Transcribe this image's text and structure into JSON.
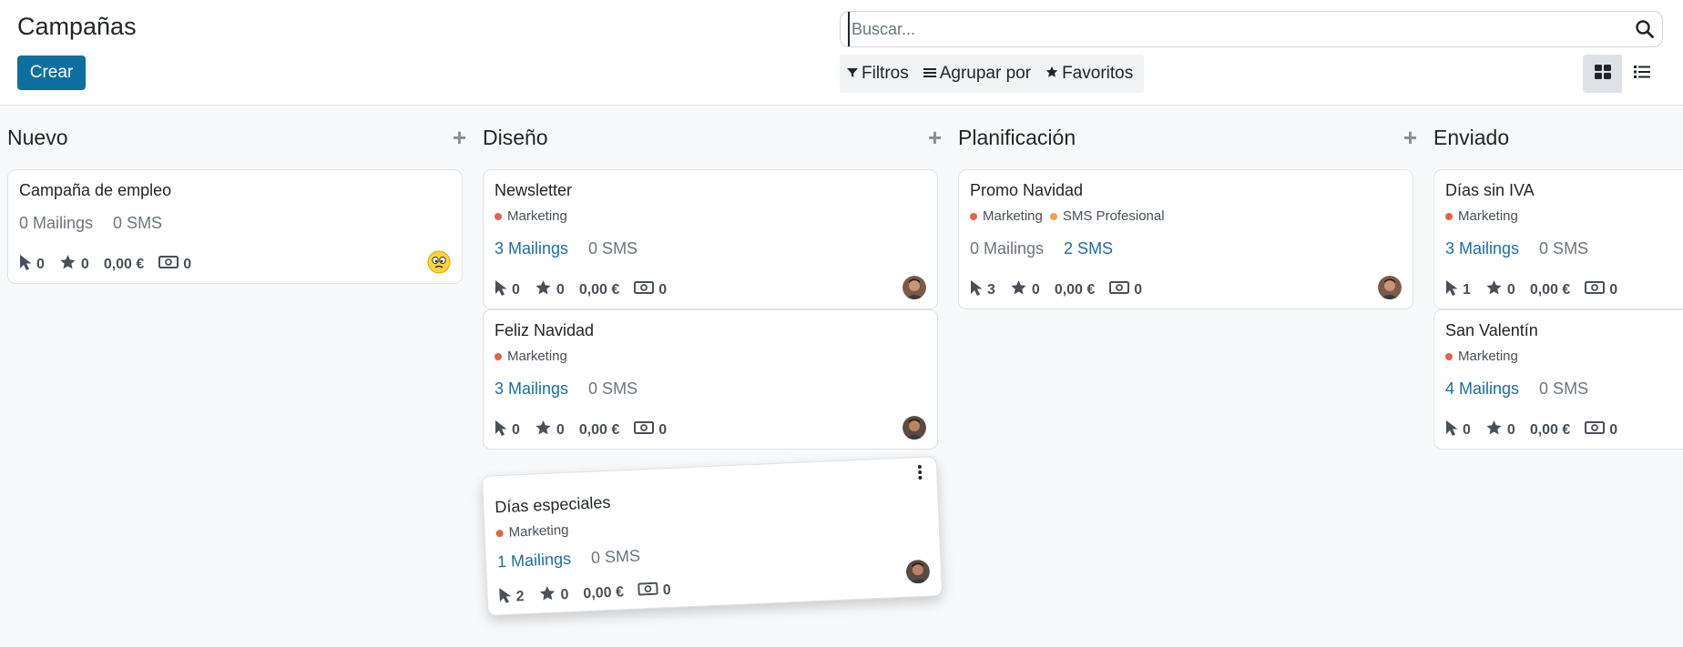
{
  "page": {
    "title": "Campañas"
  },
  "toolbar": {
    "create_label": "Crear"
  },
  "search": {
    "placeholder": "Buscar..."
  },
  "filters": {
    "filters_label": "Filtros",
    "group_by_label": "Agrupar por",
    "favorites_label": "Favoritos"
  },
  "views": {
    "active": "kanban",
    "kanban_icon": "grid-icon",
    "list_icon": "list-icon"
  },
  "colors": {
    "primary": "#0f6ea0",
    "link": "#1c6ea4",
    "tag_marketing": "#e8604c",
    "tag_sms": "#f0a050"
  },
  "columns": [
    {
      "title": "Nuevo",
      "cards": [
        {
          "title": "Campaña de empleo",
          "tags": [],
          "mailings": "0 Mailings",
          "sms": "0 SMS",
          "clicks": "0",
          "stars": "0",
          "revenue": "0,00 €",
          "cost": "0",
          "avatar": "emoji-avatar"
        }
      ]
    },
    {
      "title": "Diseño",
      "cards": [
        {
          "title": "Newsletter",
          "tags": [
            "Marketing"
          ],
          "mailings": "3 Mailings",
          "sms": "0 SMS",
          "clicks": "0",
          "stars": "0",
          "revenue": "0,00 €",
          "cost": "0",
          "avatar": "user-avatar"
        },
        {
          "title": "Feliz Navidad",
          "tags": [
            "Marketing"
          ],
          "mailings": "3 Mailings",
          "sms": "0 SMS",
          "clicks": "0",
          "stars": "0",
          "revenue": "0,00 €",
          "cost": "0",
          "avatar": "user-avatar"
        },
        {
          "title": "Días especiales",
          "tags": [
            "Marketing"
          ],
          "mailings": "1 Mailings",
          "sms": "0 SMS",
          "clicks": "2",
          "stars": "0",
          "revenue": "0,00 €",
          "cost": "0",
          "avatar": "user-avatar",
          "dragging": true
        }
      ]
    },
    {
      "title": "Planificación",
      "cards": [
        {
          "title": "Promo Navidad",
          "tags": [
            "Marketing",
            "SMS Profesional"
          ],
          "mailings": "0 Mailings",
          "sms": "2 SMS",
          "clicks": "3",
          "stars": "0",
          "revenue": "0,00 €",
          "cost": "0",
          "avatar": "user-avatar"
        }
      ]
    },
    {
      "title": "Enviado",
      "cards": [
        {
          "title": "Días sin IVA",
          "tags": [
            "Marketing"
          ],
          "mailings": "3 Mailings",
          "sms": "0 SMS",
          "clicks": "1",
          "stars": "0",
          "revenue": "0,00 €",
          "cost": "0"
        },
        {
          "title": "San Valentín",
          "tags": [
            "Marketing"
          ],
          "mailings": "4 Mailings",
          "sms": "0 SMS",
          "clicks": "0",
          "stars": "0",
          "revenue": "0,00 €",
          "cost": "0"
        }
      ]
    }
  ]
}
